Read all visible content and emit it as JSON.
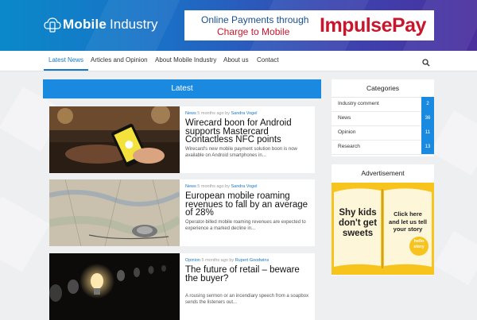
{
  "site": {
    "name_bold": "Mobile",
    "name_light": "Industry"
  },
  "banner": {
    "line1": "Online Payments through",
    "line2": "Charge to Mobile",
    "brand": "ImpulsePay"
  },
  "nav": {
    "items": [
      {
        "label": "Latest News",
        "active": true
      },
      {
        "label": "Articles and Opinion"
      },
      {
        "label": "About Mobile Industry"
      },
      {
        "label": "About us"
      },
      {
        "label": "Contact"
      }
    ],
    "search_icon": "search-icon"
  },
  "main": {
    "section_title": "Latest",
    "articles": [
      {
        "category": "News",
        "time": "5 months ago by",
        "author": "Sandra Vogel",
        "title": "Wirecard boon for Android supports Mastercard Contactless NFC points",
        "excerpt": "Wirecard's new mobile payment solution boon is now available on Android smartphones in..."
      },
      {
        "category": "News",
        "time": "5 months ago by",
        "author": "Sandra Vogel",
        "title": "European mobile roaming revenues to fall by an average of 28%",
        "excerpt": "Operator-billed mobile roaming revenues are expected to experience a marked decline in..."
      },
      {
        "category": "Opinion",
        "time": "5 months ago by",
        "author": "Rupert Goodwins",
        "title": "The future of retail – beware the buyer?",
        "excerpt": "A rousing sermon or an incendiary speech from a soapbox sends the listeners out..."
      }
    ]
  },
  "sidebar": {
    "categories_title": "Categories",
    "categories": [
      {
        "name": "Industry comment",
        "count": "2"
      },
      {
        "name": "News",
        "count": "36"
      },
      {
        "name": "Opinion",
        "count": "11"
      },
      {
        "name": "Research",
        "count": "13"
      }
    ],
    "ad_title": "Advertisement",
    "ad": {
      "left_l1": "Shy kids",
      "left_l2": "don't get",
      "left_l3": "sweets",
      "right_l1": "Click here",
      "right_l2": "and let us tell",
      "right_l3": "your story",
      "badge_l1": "hello",
      "badge_l2": "story"
    }
  },
  "colors": {
    "accent": "#1a8ae0",
    "brand_red": "#c8172c"
  }
}
